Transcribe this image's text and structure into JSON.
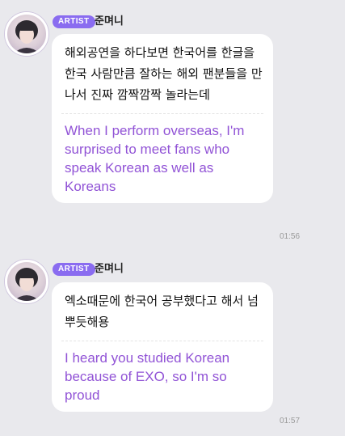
{
  "messages": [
    {
      "badge": "ARTIST",
      "sender": "준며니",
      "text_ko": "해외공연을 하다보면 한국어를 한글을 한국 사람만큼 잘하는 해외 팬분들을 만나서 진짜 깜짝깜짝 놀라는데",
      "text_en": "When I perform overseas, I'm surprised to meet fans who speak Korean as well as Koreans",
      "time": "01:56"
    },
    {
      "badge": "ARTIST",
      "sender": "준며니",
      "text_ko": "엑소때문에 한국어 공부했다고 해서 넘 뿌듯해용",
      "text_en": "I heard you studied Korean because of EXO, so I'm so proud",
      "time": "01:57"
    }
  ]
}
